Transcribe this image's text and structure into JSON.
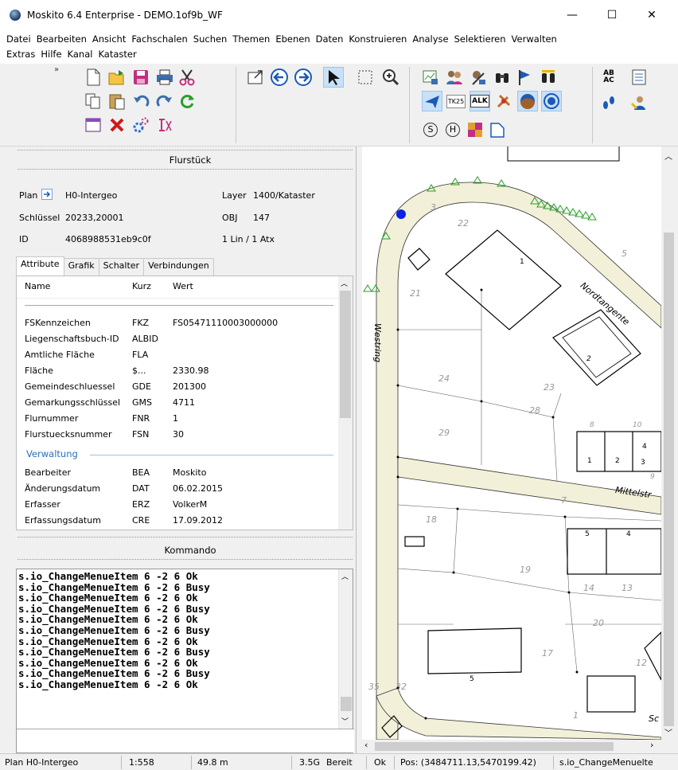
{
  "window": {
    "title": "Moskito 6.4 Enterprise - DEMO.1of9b_WF",
    "minimize": "—",
    "maximize": "☐",
    "close": "✕"
  },
  "menu": {
    "row1": [
      "Datei",
      "Bearbeiten",
      "Ansicht",
      "Fachschalen",
      "Suchen",
      "Themen",
      "Ebenen",
      "Daten",
      "Konstruieren",
      "Analyse",
      "Selektieren",
      "Verwalten"
    ],
    "row2": [
      "Extras",
      "Hilfe",
      "Kanal",
      "Kataster"
    ]
  },
  "toolbar": {
    "tk25": "TK25",
    "alk": "ALK",
    "ab_ac": "AB AC",
    "s_label": "S",
    "h_label": "H",
    "chevron": "»"
  },
  "flurstueck": {
    "title": "Flurstück",
    "plan_label": "Plan",
    "plan_value": "H0-Intergeo",
    "layer_label": "Layer",
    "layer_value": "1400/Kataster",
    "schluessel_label": "Schlüssel",
    "schluessel_value": "20233,20001",
    "obj_label": "OBJ",
    "obj_value": "147",
    "id_label": "ID",
    "id_value": "4068988531eb9c0f",
    "lin_value": "1 Lin / 1 Atx",
    "tabs": [
      "Attribute",
      "Grafik",
      "Schalter",
      "Verbindungen"
    ],
    "columns": {
      "name": "Name",
      "kurz": "Kurz",
      "wert": "Wert"
    },
    "rows": [
      {
        "name": "FSKennzeichen",
        "kurz": "FKZ",
        "wert": "FS05471110003000000"
      },
      {
        "name": "Liegenschaftsbuch-ID",
        "kurz": "ALBID",
        "wert": ""
      },
      {
        "name": "Amtliche Fläche",
        "kurz": "FLA",
        "wert": ""
      },
      {
        "name": "Fläche",
        "kurz": "$...",
        "wert": "2330.98"
      },
      {
        "name": "Gemeindeschluessel",
        "kurz": "GDE",
        "wert": "201300"
      },
      {
        "name": "Gemarkungsschlüssel",
        "kurz": "GMS",
        "wert": "4711"
      },
      {
        "name": "Flurnummer",
        "kurz": "FNR",
        "wert": "1"
      },
      {
        "name": "Flurstuecksnummer",
        "kurz": "FSN",
        "wert": "30"
      }
    ],
    "group": "Verwaltung",
    "rows2": [
      {
        "name": "Bearbeiter",
        "kurz": "BEA",
        "wert": "Moskito"
      },
      {
        "name": "Änderungsdatum",
        "kurz": "DAT",
        "wert": "06.02.2015"
      },
      {
        "name": "Erfasser",
        "kurz": "ERZ",
        "wert": "VolkerM"
      },
      {
        "name": "Erfassungsdatum",
        "kurz": "CRE",
        "wert": "17.09.2012"
      }
    ]
  },
  "kommando": {
    "title": "Kommando",
    "lines": [
      "s.io_ChangeMenueItem 6 -2 6 Ok",
      "s.io_ChangeMenueItem 6 -2 6 Busy",
      "s.io_ChangeMenueItem 6 -2 6 Ok",
      "s.io_ChangeMenueItem 6 -2 6 Busy",
      "s.io_ChangeMenueItem 6 -2 6 Ok",
      "s.io_ChangeMenueItem 6 -2 6 Busy",
      "s.io_ChangeMenueItem 6 -2 6 Ok",
      "s.io_ChangeMenueItem 6 -2 6 Busy",
      "s.io_ChangeMenueItem 6 -2 6 Ok",
      "s.io_ChangeMenueItem 6 -2 6 Busy",
      "s.io_ChangeMenueItem 6 -2 6 Ok"
    ]
  },
  "map": {
    "streets": {
      "westring": "Westring",
      "nordtangente": "Nordtangente",
      "mittelstr": "Mittelstr",
      "sc": "Sc"
    },
    "parcels": [
      "3",
      "22",
      "5",
      "1",
      "21",
      "2",
      "24",
      "23",
      "28",
      "29",
      "8",
      "10",
      "1",
      "2",
      "3",
      "4",
      "9",
      "7",
      "18",
      "5",
      "4",
      "19",
      "14",
      "13",
      "20",
      "17",
      "12",
      "5",
      "35",
      "32",
      "1"
    ]
  },
  "status": {
    "plan": "Plan H0-Intergeo",
    "scale": "1:558",
    "dist": "49.8 m",
    "mem": "3.5G",
    "state": "Bereit",
    "ok": "Ok",
    "pos": "Pos: (3484711.13,5470199.42)",
    "cmd": "s.io_ChangeMenuelte"
  },
  "colors": {
    "road_fill": "#f2f0d8",
    "highlight": "#c8e0f8",
    "marker": "#0c22e6",
    "group_blue": "#2b6fb5"
  }
}
